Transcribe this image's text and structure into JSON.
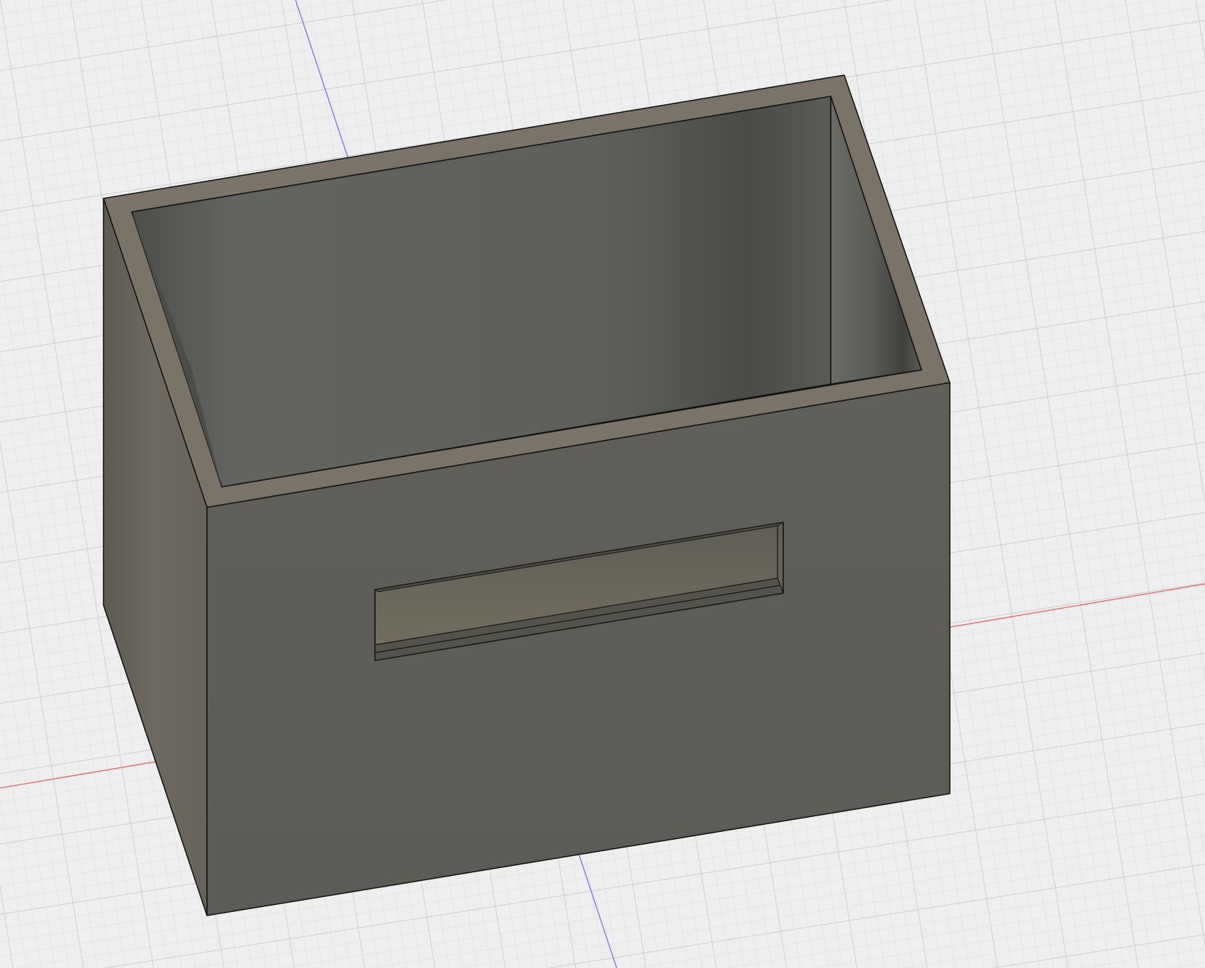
{
  "canvas": {
    "view": "3d-viewport",
    "background_color": "#eeeeee",
    "grid": {
      "visible": true,
      "minor_color": "#d9d9d9",
      "major_color": "#c6c6c6"
    },
    "axes": [
      {
        "name": "x-axis",
        "color": "#e8605f"
      },
      {
        "name": "y-axis",
        "color": "#6f6ff0"
      }
    ]
  },
  "model": {
    "type": "open-box",
    "features": [
      "open-top",
      "front-slot"
    ],
    "colors": {
      "outer_face": "#5e5e58",
      "side_face": "#6a665e",
      "rim": "#7a7468",
      "inner_back_wall": "#5f605b",
      "inner_side_wall": "#4c4d49",
      "slot_inner": "#6b685c",
      "edge": "#121212"
    }
  }
}
